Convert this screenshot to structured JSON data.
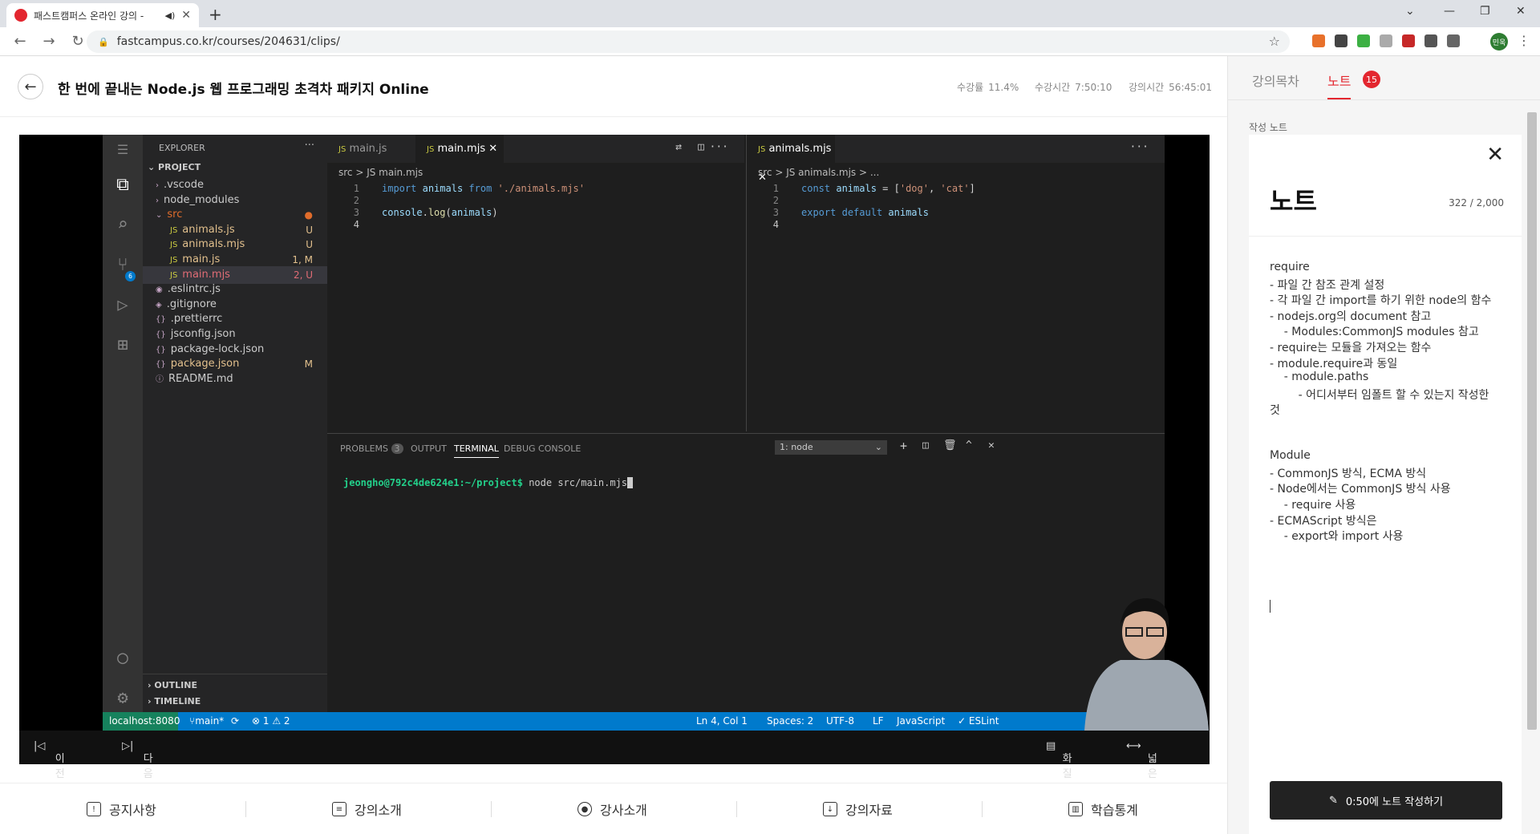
{
  "browser": {
    "tab_title": "패스트캠퍼스 온라인 강의 -",
    "url": "fastcampus.co.kr/courses/204631/clips/",
    "profile": "민욱"
  },
  "course": {
    "title": "한 번에 끝내는 Node.js 웹 프로그래밍 초격차 패키지 Online",
    "progress_label": "수강률",
    "progress_value": "11.4%",
    "watch_label": "수강시간",
    "watch_value": "7:50:10",
    "total_label": "강의시간",
    "total_value": "56:45:01"
  },
  "vscode": {
    "explorer_label": "EXPLORER",
    "project_label": "PROJECT",
    "files": [
      {
        "name": ".vscode",
        "status": ""
      },
      {
        "name": "node_modules",
        "status": ""
      },
      {
        "name": "src",
        "status": "●"
      },
      {
        "name": "animals.js",
        "status": "U"
      },
      {
        "name": "animals.mjs",
        "status": "U"
      },
      {
        "name": "main.js",
        "status": "1, M"
      },
      {
        "name": "main.mjs",
        "status": "2, U"
      },
      {
        "name": ".eslintrc.js",
        "status": ""
      },
      {
        "name": ".gitignore",
        "status": ""
      },
      {
        "name": ".prettierrc",
        "status": ""
      },
      {
        "name": "jsconfig.json",
        "status": ""
      },
      {
        "name": "package-lock.json",
        "status": ""
      },
      {
        "name": "package.json",
        "status": "M"
      },
      {
        "name": "README.md",
        "status": ""
      }
    ],
    "outline": "OUTLINE",
    "timeline": "TIMELINE",
    "left_tabs": [
      "main.js",
      "main.mjs"
    ],
    "left_crumb": "src > JS main.mjs",
    "right_tab": "animals.mjs",
    "right_crumb": "src > JS animals.mjs > ...",
    "left_code": [
      "import animals from './animals.mjs'",
      "",
      "console.log(animals)",
      ""
    ],
    "right_code": [
      "const animals = ['dog', 'cat']",
      "",
      "export default animals",
      ""
    ],
    "panel_tabs": {
      "problems": "PROBLEMS",
      "problems_count": "3",
      "output": "OUTPUT",
      "terminal": "TERMINAL",
      "debug": "DEBUG CONSOLE"
    },
    "terminal_select": "1: node",
    "terminal_prompt": "jeongho@792c4de624e1:~/project$",
    "terminal_cmd": " node src/main.mjs",
    "status": {
      "remote": "localhost:8080",
      "branch": "main*",
      "problems": "⊗ 1 ⚠ 2",
      "position": "Ln 4, Col 1",
      "spaces": "Spaces: 2",
      "encoding": "UTF-8",
      "eol": "LF",
      "lang": "JavaScript",
      "eslint": "✓ ESLint"
    },
    "scm_badge": "6"
  },
  "player": {
    "prev": "이전 강의",
    "next": "다음 강의",
    "quality": "화질 설정",
    "wide": "넓은 화면"
  },
  "bottom_nav": [
    "공지사항",
    "강의소개",
    "강사소개",
    "강의자료",
    "학습통계"
  ],
  "notes_panel": {
    "tab_toc": "강의목차",
    "tab_notes": "노트",
    "notes_count": "15",
    "section": "작성 노트",
    "title": "노트",
    "char_count": "322 / 2,000",
    "lines": [
      "require",
      "- 파일 간 참조 관계 설정",
      "- 각 파일 간 import를 하기 위한 node의 함수",
      "- nodejs.org의 document 참고",
      "    - Modules:CommonJS modules 참고",
      "- require는 모듈을 가져오는 함수",
      "- module.require과 동일",
      "    - module.paths",
      "        - 어디서부터 임폴트 할 수 있는지 작성한",
      "것",
      "",
      "",
      "Module",
      "- CommonJS 방식, ECMA 방식",
      "- Node에서는 CommonJS 방식 사용",
      "    - require 사용",
      "- ECMAScript 방식은",
      "    - export와 import 사용"
    ],
    "write_button": "0:50에 노트 작성하기"
  }
}
